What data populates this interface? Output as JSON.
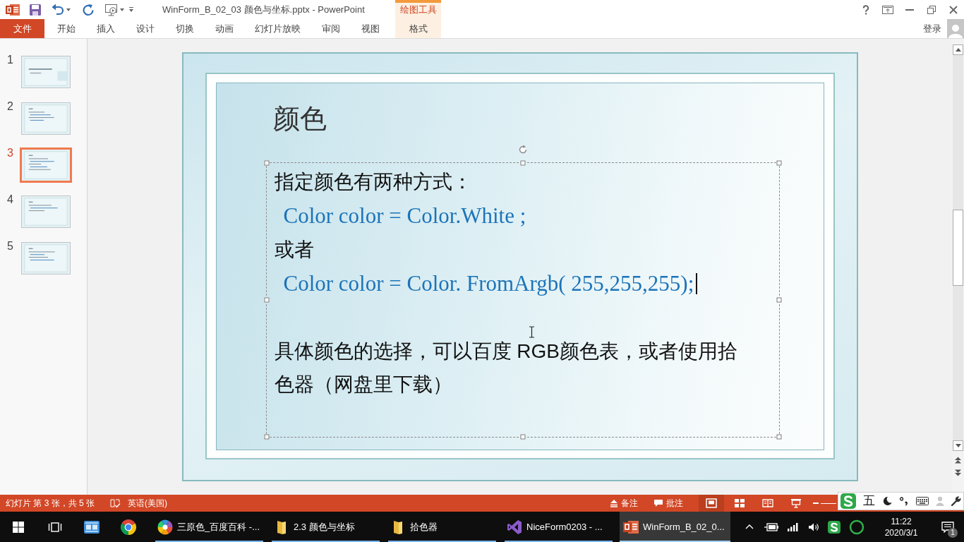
{
  "window": {
    "title": "WinForm_B_02_03 颜色与坐标.pptx - PowerPoint",
    "tool_group": "绘图工具"
  },
  "ribbon": {
    "tabs": [
      {
        "label": "文件",
        "kind": "file",
        "selected": false
      },
      {
        "label": "开始",
        "kind": "tab",
        "selected": false
      },
      {
        "label": "插入",
        "kind": "tab",
        "selected": false
      },
      {
        "label": "设计",
        "kind": "tab",
        "selected": false
      },
      {
        "label": "切换",
        "kind": "tab",
        "selected": false
      },
      {
        "label": "动画",
        "kind": "tab",
        "selected": false
      },
      {
        "label": "幻灯片放映",
        "kind": "tab",
        "selected": false
      },
      {
        "label": "审阅",
        "kind": "tab",
        "selected": false
      },
      {
        "label": "视图",
        "kind": "tab",
        "selected": false
      },
      {
        "label": "格式",
        "kind": "contextual",
        "selected": false
      }
    ],
    "sign_in": "登录"
  },
  "slides_pane": {
    "thumbnails": [
      {
        "number": "1",
        "selected": false
      },
      {
        "number": "2",
        "selected": false
      },
      {
        "number": "3",
        "selected": true
      },
      {
        "number": "4",
        "selected": false
      },
      {
        "number": "5",
        "selected": false
      }
    ]
  },
  "slide": {
    "title": "颜色",
    "body": [
      {
        "kind": "text",
        "text": "指定颜色有两种方式："
      },
      {
        "kind": "code",
        "text": "Color color = Color.White ;",
        "caret": false
      },
      {
        "kind": "text",
        "text": "或者"
      },
      {
        "kind": "code",
        "text": "Color color = Color. FromArgb( 255,255,255);",
        "caret": true
      },
      {
        "kind": "spacer"
      },
      {
        "kind": "text",
        "text": "具体颜色的选择，可以百度 RGB颜色表，或者使用拾色器（网盘里下载）"
      }
    ]
  },
  "status_bar": {
    "slide_info": "幻灯片 第 3 张，共 5 张",
    "language": "英语(美国)",
    "notes": "备注",
    "comments": "批注",
    "views": [
      {
        "kind": "normal",
        "selected": true
      },
      {
        "kind": "sorter",
        "selected": false
      },
      {
        "kind": "reading",
        "selected": false
      },
      {
        "kind": "slideshow",
        "selected": false
      }
    ]
  },
  "ime_toolbar": {
    "mode": "五"
  },
  "taskbar": {
    "apps": [
      {
        "kind": "colorwheel",
        "label": "三原色_百度百科 -...",
        "selected": false
      },
      {
        "kind": "folder",
        "label": "2.3 颜色与坐标",
        "selected": false
      },
      {
        "kind": "folder",
        "label": "拾色器",
        "selected": false
      },
      {
        "kind": "vs",
        "label": "NiceForm0203 - ...",
        "selected": false
      },
      {
        "kind": "ppt",
        "label": "WinForm_B_02_0...",
        "selected": true
      }
    ],
    "clock": {
      "time": "11:22",
      "date": "2020/3/1"
    },
    "notifications": "1"
  }
}
